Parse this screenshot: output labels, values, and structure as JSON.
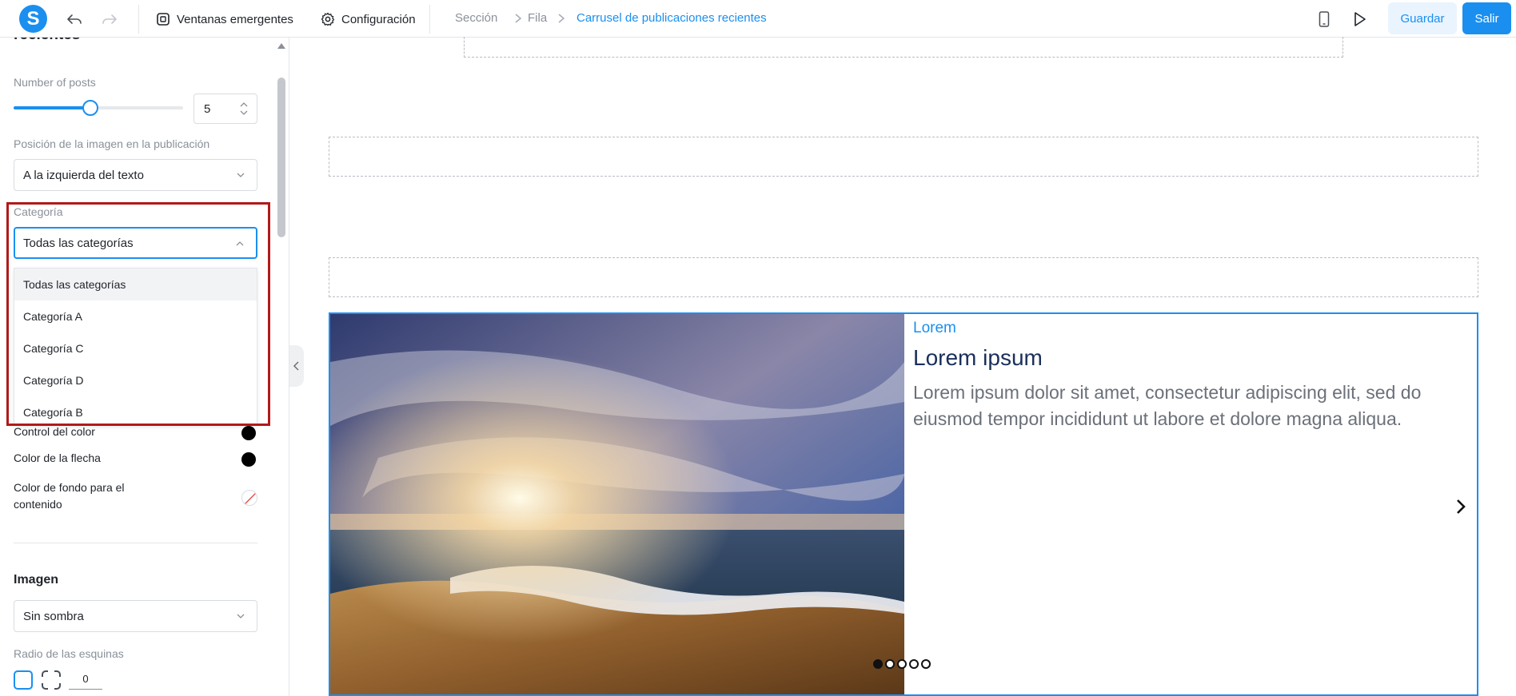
{
  "toolbar": {
    "logo_letter": "S",
    "popups_label": "Ventanas emergentes",
    "settings_label": "Configuración",
    "breadcrumb": [
      "Sección",
      "Fila",
      "Carrusel de publicaciones recientes"
    ],
    "save_label": "Guardar",
    "exit_label": "Salir"
  },
  "panel": {
    "heading": "recientes",
    "posts_label": "Number of posts",
    "posts_value": "5",
    "posts_slider_fraction": 0.37,
    "image_position_label": "Posición de la imagen en la publicación",
    "image_position_value": "A la izquierda del texto",
    "category_label": "Categoría",
    "category_value": "Todas las categorías",
    "category_options": [
      "Todas las categorías",
      "Categoría A",
      "Categoría C",
      "Categoría D",
      "Categoría B"
    ],
    "control_color_label": "Control del color",
    "arrow_color_label": "Color de la flecha",
    "content_bg_label": "Color de fondo para el contenido",
    "image_section_title": "Imagen",
    "shadow_value": "Sin sombra",
    "corner_radius_label": "Radio de las esquinas",
    "corner_radius_value": "0"
  },
  "carousel": {
    "category": "Lorem",
    "title": "Lorem ipsum",
    "text": "Lorem ipsum dolor sit amet, consectetur adipiscing elit, sed do eiusmod tempor incididunt ut labore et dolore magna aliqua.",
    "page_count": 5,
    "active_page": 1
  },
  "colors": {
    "accent": "#1a8ff0",
    "highlight": "#b11a1a",
    "title": "#1a2f5a"
  }
}
